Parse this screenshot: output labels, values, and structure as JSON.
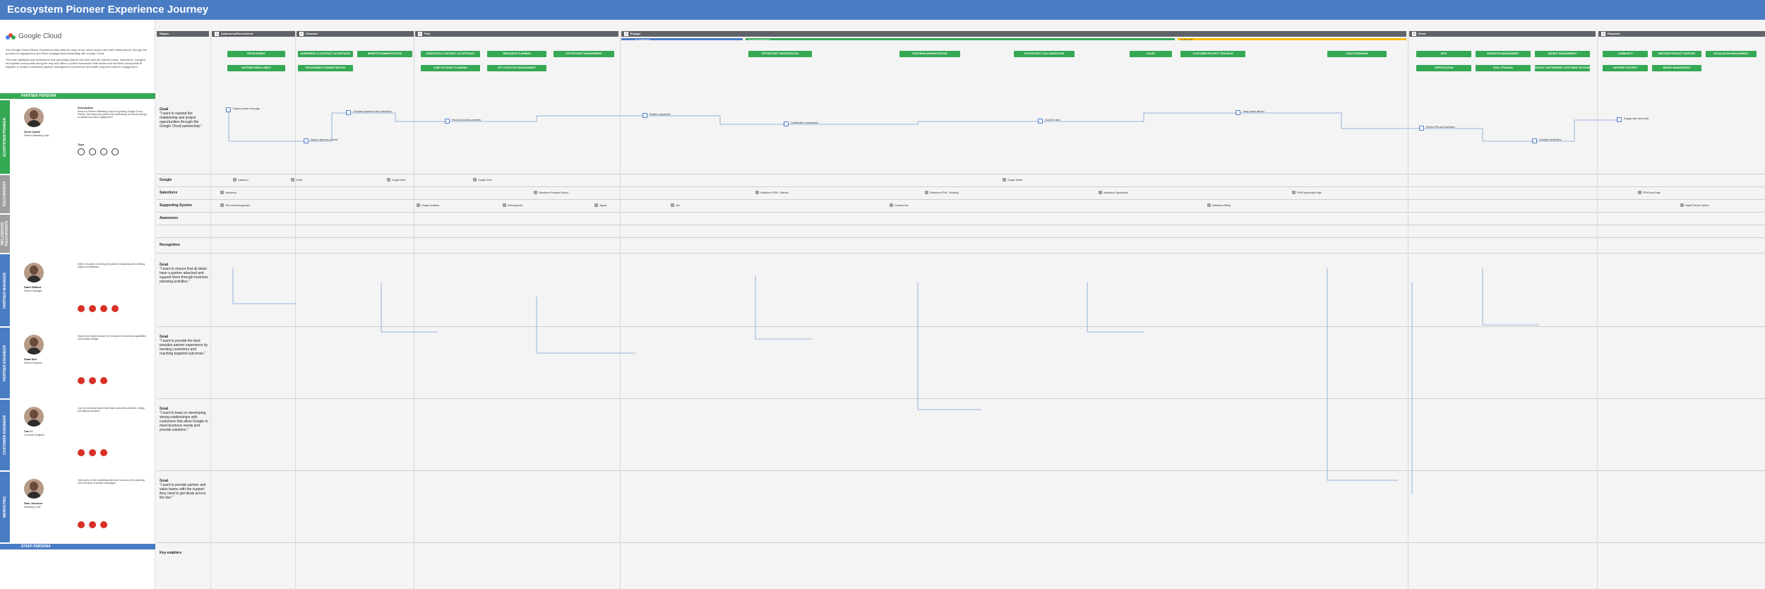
{
  "title": "Ecosystem Pioneer Experience Journey",
  "logo_text": "Google Cloud",
  "intro": [
    "The Google Cloud Partner Experience Map tells the story of our seven Actors and their Initial actions, through the process of engagement and future engagement/onboarding with Google Cloud.",
    "The map highlights key interactions that (potential) partner will have with the partner portal, Salesforce, Google's and system touchpoints along the way and offers a unified framework that shows how all these touchpoints fit together to create a seamless pipeline management experience and foster long term partner engagement."
  ],
  "bands": {
    "partner_persona": "PARTNER PERSONA",
    "staff_persona": "STAFF PERSONA",
    "ecosystem_pioneer": "ECOSYSTEM PIONEER",
    "touchpoints": "TOUCHPOINTS",
    "influenced_by": "INFLUENCED TOUCHPOINTS",
    "partner_manager": "PARTNER MANAGER",
    "partner_engineer": "PARTNER ENGINEER",
    "customer_engineer": "CUSTOMER ENGINEER",
    "marketing": "MARKETING"
  },
  "stages": [
    {
      "num": "",
      "label": "Stages"
    },
    {
      "num": "1",
      "label": "Awareness/Recruitment"
    },
    {
      "num": "2",
      "label": "Onboard"
    },
    {
      "num": "3",
      "label": "Plan"
    },
    {
      "num": "4",
      "label": "Engage"
    },
    {
      "num": "5",
      "label": "Grow"
    },
    {
      "num": "6",
      "label": "Empower"
    }
  ],
  "engage_sub": [
    "Co-Sell Engage",
    "Co-sell: Internal Motion",
    "Co-sell: Fulfil"
  ],
  "pills": [
    "RECRUITMENT",
    "PARTNER ENROLLMENT",
    "AGREEMENT & CONTRACT ACCEPTANCE",
    "ENGAGEMENT ADMINISTRATION",
    "BENEFITS ADMINISTRATION",
    "INCENTIVE & CONTRACT ACCEPTANCE",
    "JOINT ACCOUNT PLANNING",
    "RESOURCE PLANNING",
    "GTT LIFECYCLE MANAGEMENT",
    "OPPORTUNITY MANAGEMENT",
    "OPPORTUNITY REGISTRATION",
    "PROGRAM ADMINISTRATION",
    "OPPORTUNITY COLLABORATION",
    "SALES",
    "CUSTOMER PROJECT TRACKING",
    "LEAD EXPANSION",
    "KPIS",
    "INCENTIVE MANAGEMENT",
    "INSIGHT MANAGEMENT",
    "CERTIFICATION",
    "SKILL TRAINING",
    "DIGITAL PARTNERSHIP CUSTOMER SUCCESS PLANS",
    "COMMUNITY",
    "PARTNER PRODUCT SUPPORT",
    "ESCALATION MANAGEMENT",
    "PARTNER CONTENT",
    "BRAND MANAGEMENT"
  ],
  "personas": {
    "pioneer": {
      "name": "Serai Castle",
      "role": "Partner Marketing Lead",
      "desc_title": "Description",
      "desc": "Serai is a Partner Marketing Lead at a growing Google Cloud Partner. She leads the partnership relationship and drives joint go-to-market and sales engagement.",
      "type_label": "Type",
      "goal_title": "Goal",
      "goal": "\"I want to expand the relationship and project opportunities through the Google Cloud partnership.\""
    },
    "manager": {
      "name": "Dafni Willard",
      "role": "Partner Manager",
      "desc": "Dafni is focused on driving the partner relationship and meeting target commitments.",
      "goal": "\"I want to ensure that all deals have a partner attached and support them through business planning activities.\""
    },
    "engineer": {
      "name": "Saad Akri",
      "role": "Partner Engineer",
      "desc": "Saad is the trusted advisor for the partner's technical capabilities and solution design.",
      "goal": "\"I want to provide the best possible partner experience by meeting customers and reaching targeted outcomes.\""
    },
    "customer_eng": {
      "name": "Cae Li",
      "role": "Customer Engineer",
      "desc": "Cae is a technical leader that helps customers architect, design and deploy solutions.",
      "goal": "\"I want to keep on developing strong relationships with customers that allow Google to meet business needs and provide solutions.\""
    },
    "marketing": {
      "name": "Sam Johnson",
      "role": "Marketing Lead",
      "desc": "Sam works on the marketing team and focuses on the planning and execution of partner campaigns.",
      "goal": "\"I want to provide partner and sales teams with the support they need to get deals across the line.\""
    }
  },
  "systems": {
    "google": "Google",
    "salesforce": "Salesforce",
    "supporting": "Supporting System",
    "awareness": "Awareness",
    "recognition": "Recognition",
    "key_enablers": "Key enablers"
  },
  "google_items": [
    "Gallery.co",
    "Gmail",
    "Google Meet",
    "Google Drive",
    "Google Slides"
  ],
  "sf_items": [
    "Salesforce",
    "Salesforce Prospect Record",
    "Salesforce PRM - Pipeline",
    "Salesforce PRM - Bundling",
    "Salesforce Opportunity",
    "PRM Opportunity Page",
    "PRM Lead Page"
  ],
  "support_items": [
    "SIM Lead Management",
    "Google Analytics",
    "Partnergrowth",
    "Jigsaw",
    "Jira",
    "Contract hub",
    "Salesforce Billing",
    "Digital Partner System"
  ],
  "flow_notes": [
    "Explore partner web page",
    "Apply to become a partner",
    "Complete agreement and onboarding",
    "Plan joint business activities",
    "Register opportunity",
    "Collaborate on opportunity",
    "Close the deal",
    "Track project delivery",
    "Review KPIs and incentives",
    "Complete certification",
    "Engage with community"
  ],
  "colors": {
    "header": "#4a7cc4",
    "pill": "#34a853",
    "persona_green": "#34a853",
    "persona_gray": "#9e9e9e",
    "staff_blue": "#4a7cc4",
    "stage_gray": "#5f6368",
    "dot_red": "#d93025"
  }
}
